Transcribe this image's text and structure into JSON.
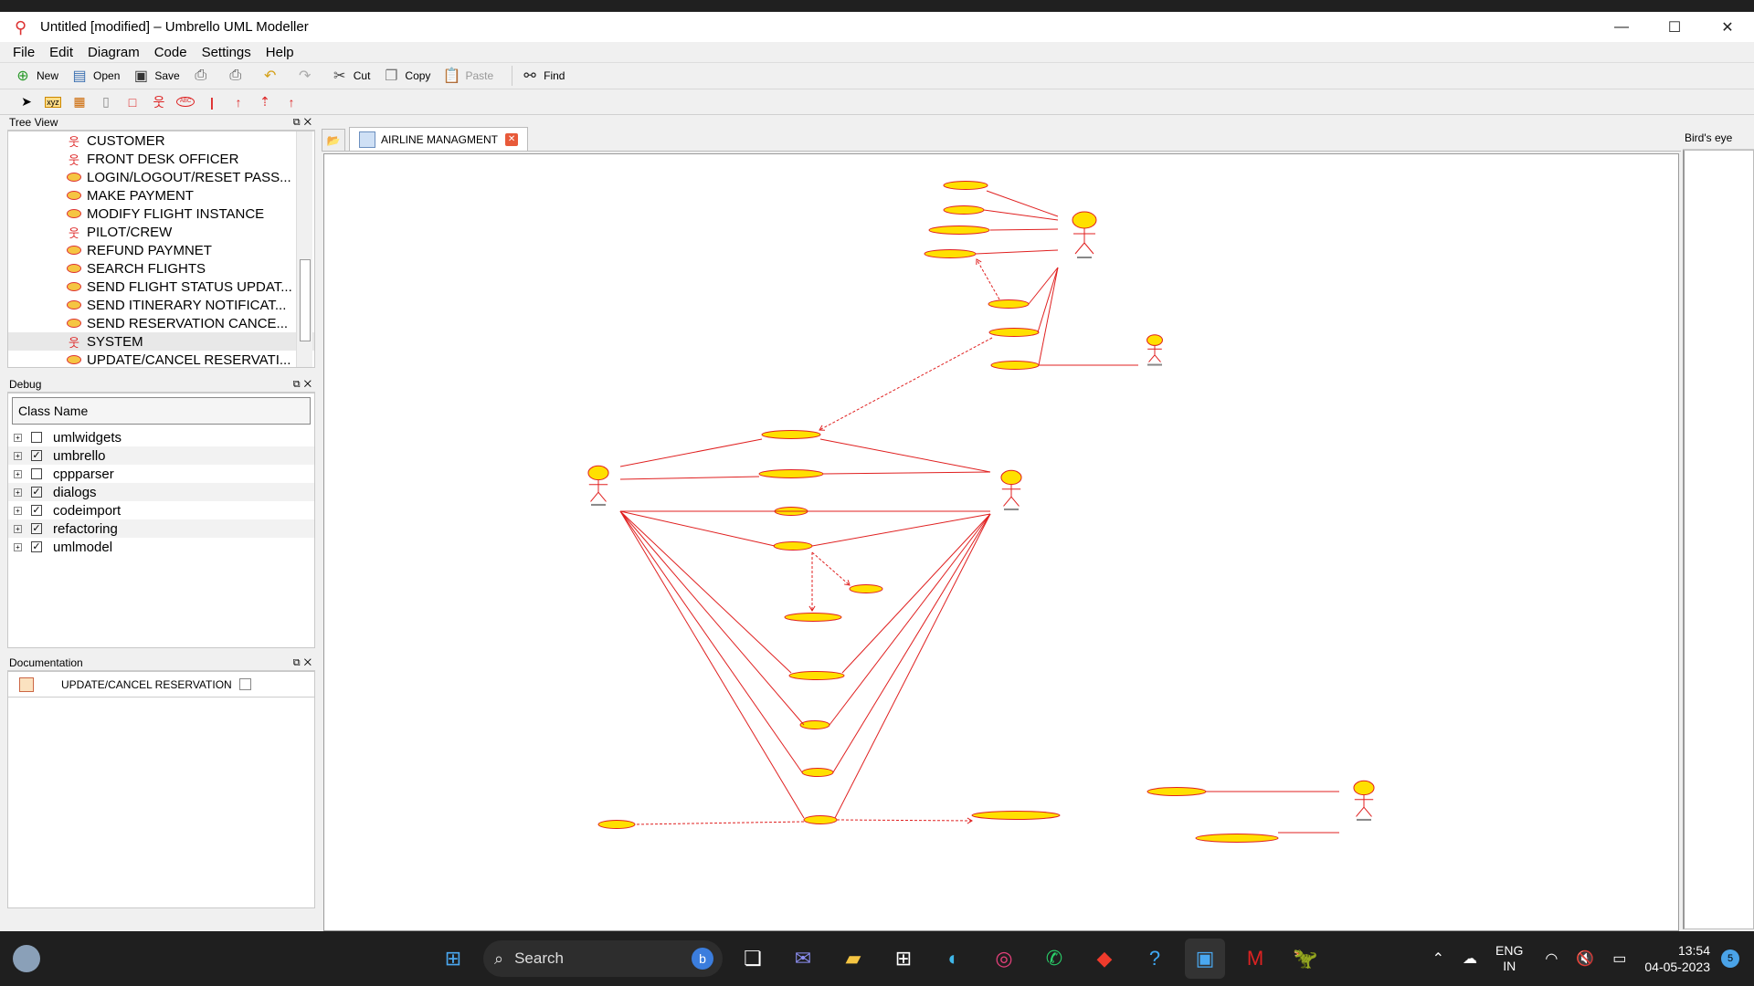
{
  "window": {
    "title": "Untitled [modified] – Umbrello UML Modeller"
  },
  "menu": [
    "File",
    "Edit",
    "Diagram",
    "Code",
    "Settings",
    "Help"
  ],
  "toolbar": {
    "new": "New",
    "open": "Open",
    "save": "Save",
    "cut": "Cut",
    "copy": "Copy",
    "paste": "Paste",
    "find": "Find"
  },
  "tree_view": {
    "title": "Tree View",
    "items": [
      {
        "label": "CUSTOMER",
        "kind": "actor"
      },
      {
        "label": "FRONT DESK OFFICER",
        "kind": "actor"
      },
      {
        "label": "LOGIN/LOGOUT/RESET PASS...",
        "kind": "usecase"
      },
      {
        "label": "MAKE PAYMENT",
        "kind": "usecase"
      },
      {
        "label": "MODIFY FLIGHT INSTANCE",
        "kind": "usecase"
      },
      {
        "label": "PILOT/CREW",
        "kind": "actor"
      },
      {
        "label": "REFUND PAYMNET",
        "kind": "usecase"
      },
      {
        "label": "SEARCH FLIGHTS",
        "kind": "usecase"
      },
      {
        "label": "SEND FLIGHT STATUS UPDAT...",
        "kind": "usecase"
      },
      {
        "label": "SEND ITINERARY NOTIFICAT...",
        "kind": "usecase"
      },
      {
        "label": "SEND RESERVATION CANCE...",
        "kind": "usecase"
      },
      {
        "label": "SYSTEM",
        "kind": "actor"
      },
      {
        "label": "UPDATE/CANCEL RESERVATI...",
        "kind": "usecase"
      }
    ]
  },
  "debug": {
    "title": "Debug",
    "column": "Class Name",
    "rows": [
      {
        "label": "umlwidgets",
        "checked": false
      },
      {
        "label": "umbrello",
        "checked": true
      },
      {
        "label": "cppparser",
        "checked": false
      },
      {
        "label": "dialogs",
        "checked": true
      },
      {
        "label": "codeimport",
        "checked": true
      },
      {
        "label": "refactoring",
        "checked": true
      },
      {
        "label": "umlmodel",
        "checked": true
      }
    ]
  },
  "documentation": {
    "title": "Documentation",
    "item": "UPDATE/CANCEL RESERVATION"
  },
  "diagram_tab": {
    "label": "AIRLINE MANAGMENT"
  },
  "birds_eye": {
    "title": "Bird's eye"
  },
  "taskbar": {
    "search": "Search",
    "lang1": "ENG",
    "lang2": "IN",
    "time": "13:54",
    "date": "04-05-2023",
    "notifications": "5"
  },
  "colors": {
    "uml_line": "#e02020",
    "usecase_fill": "#ffe000",
    "accent": "#0078d4"
  }
}
